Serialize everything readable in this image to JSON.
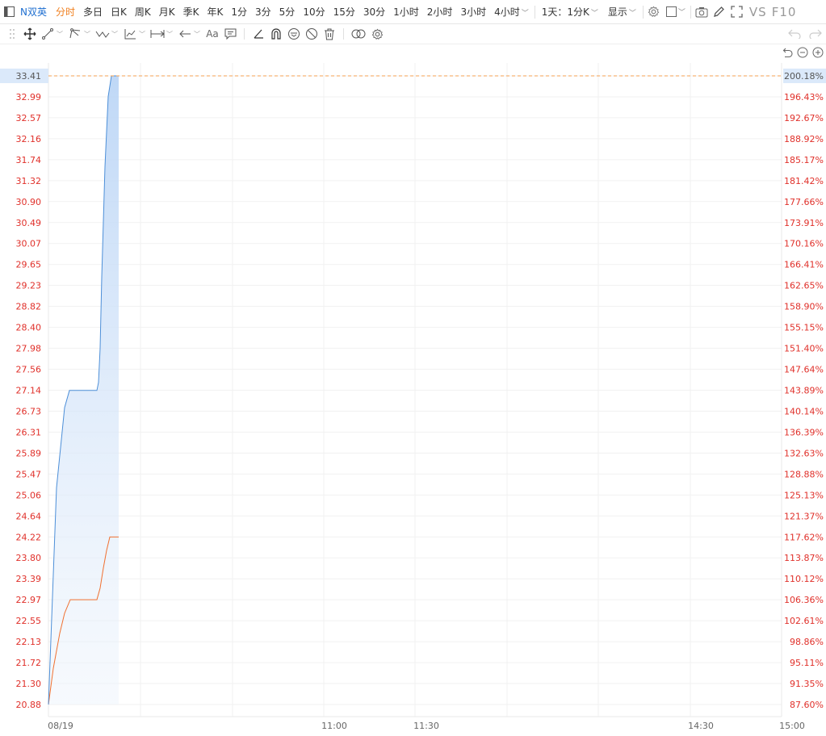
{
  "toolbar": {
    "stock_name": "N双英",
    "periods": [
      "分时",
      "多日",
      "日K",
      "周K",
      "月K",
      "季K",
      "年K",
      "1分",
      "3分",
      "5分",
      "10分",
      "15分",
      "30分",
      "1小时",
      "2小时",
      "3小时",
      "4小时"
    ],
    "active_period": "分时",
    "multi_frame_label": "1天：1分K",
    "display_label": "显示",
    "vs_label": "VS",
    "f10_label": "F10"
  },
  "drawing_toolbar": {
    "text_tool_label": "Aa"
  },
  "colors": {
    "accent_orange": "#f08020",
    "price_line": "#4d8fd8",
    "avg_line": "#f07030",
    "up_red": "#e0302a",
    "ref_dashed": "#f5a050"
  },
  "chart_data": {
    "type": "line",
    "y_left_ticks": [
      "33.41",
      "32.99",
      "32.57",
      "32.16",
      "31.74",
      "31.32",
      "30.90",
      "30.49",
      "30.07",
      "29.65",
      "29.23",
      "28.82",
      "28.40",
      "27.98",
      "27.56",
      "27.14",
      "26.73",
      "26.31",
      "25.89",
      "25.47",
      "25.06",
      "24.64",
      "24.22",
      "23.80",
      "23.39",
      "22.97",
      "22.55",
      "22.13",
      "21.72",
      "21.30",
      "20.88"
    ],
    "y_right_ticks": [
      "200.18%",
      "196.43%",
      "192.67%",
      "188.92%",
      "185.17%",
      "181.42%",
      "177.66%",
      "173.91%",
      "170.16%",
      "166.41%",
      "162.65%",
      "158.90%",
      "155.15%",
      "151.40%",
      "147.64%",
      "143.89%",
      "140.14%",
      "136.39%",
      "132.63%",
      "128.88%",
      "125.13%",
      "121.37%",
      "117.62%",
      "113.87%",
      "110.12%",
      "106.36%",
      "102.61%",
      "98.86%",
      "95.11%",
      "91.35%",
      "87.60%"
    ],
    "ylim": [
      20.88,
      33.41
    ],
    "x_labels": [
      "08/19",
      "11:00",
      "11:30",
      "14:30",
      "15:00"
    ],
    "highlighted_price": "33.41",
    "highlighted_pct": "200.18%",
    "series": [
      {
        "role": "price",
        "points": [
          [
            0,
            20.88
          ],
          [
            4,
            22.6
          ],
          [
            10,
            25.2
          ],
          [
            20,
            26.8
          ],
          [
            26,
            27.14
          ],
          [
            60,
            27.14
          ],
          [
            62,
            27.3
          ],
          [
            64,
            27.98
          ],
          [
            66,
            29.4
          ],
          [
            70,
            31.6
          ],
          [
            74,
            33.0
          ],
          [
            78,
            33.41
          ],
          [
            87,
            33.41
          ]
        ]
      },
      {
        "role": "average",
        "points": [
          [
            0,
            20.88
          ],
          [
            6,
            21.6
          ],
          [
            14,
            22.3
          ],
          [
            20,
            22.7
          ],
          [
            27,
            22.97
          ],
          [
            60,
            22.97
          ],
          [
            64,
            23.2
          ],
          [
            68,
            23.6
          ],
          [
            72,
            23.95
          ],
          [
            76,
            24.22
          ],
          [
            87,
            24.22
          ]
        ]
      }
    ]
  }
}
